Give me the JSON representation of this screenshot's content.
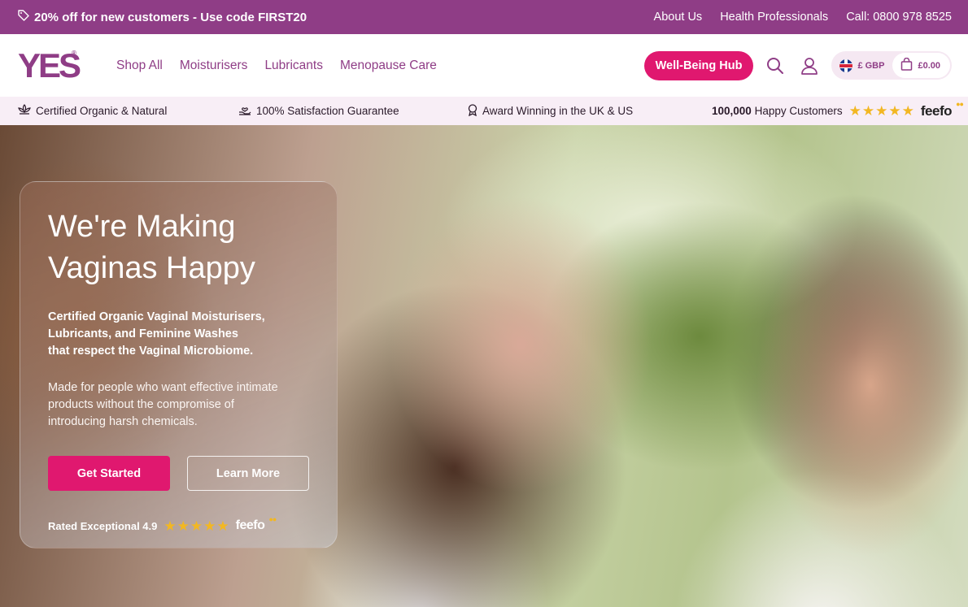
{
  "promo": {
    "text": "20% off for new customers - Use code FIRST20",
    "icon": "tag-icon",
    "links": [
      "About Us",
      "Health Professionals",
      "Call: 0800 978 8525"
    ]
  },
  "header": {
    "logo": "YES",
    "logo_mark": "®",
    "nav": [
      "Shop All",
      "Moisturisers",
      "Lubricants",
      "Menopause Care"
    ],
    "wellbeing_button": "Well-Being Hub",
    "currency": "£ GBP",
    "cart_total": "£0.00",
    "accent": "#8f3d86",
    "button_color": "#e0186f"
  },
  "trust": {
    "items": [
      "Certified Organic & Natural",
      "100% Satisfaction Guarantee",
      "Award Winning in the UK & US"
    ],
    "customers_count": "100,000",
    "customers_label": "Happy Customers",
    "rating_stars": 5,
    "rating_brand": "feefo"
  },
  "hero": {
    "title_line1": "We're Making",
    "title_line2": "Vaginas Happy",
    "subtitle_line1": "Certified Organic Vaginal Moisturisers,",
    "subtitle_line2": "Lubricants, and Feminine Washes",
    "subtitle_line3": "that respect the Vaginal Microbiome.",
    "desc_line1": "Made for people who want effective intimate",
    "desc_line2": "products without the compromise of",
    "desc_line3": "introducing harsh chemicals.",
    "primary_button": "Get Started",
    "secondary_button": "Learn More",
    "rating_text": "Rated Exceptional 4.9",
    "rating_stars": 5,
    "rating_brand": "feefo"
  }
}
